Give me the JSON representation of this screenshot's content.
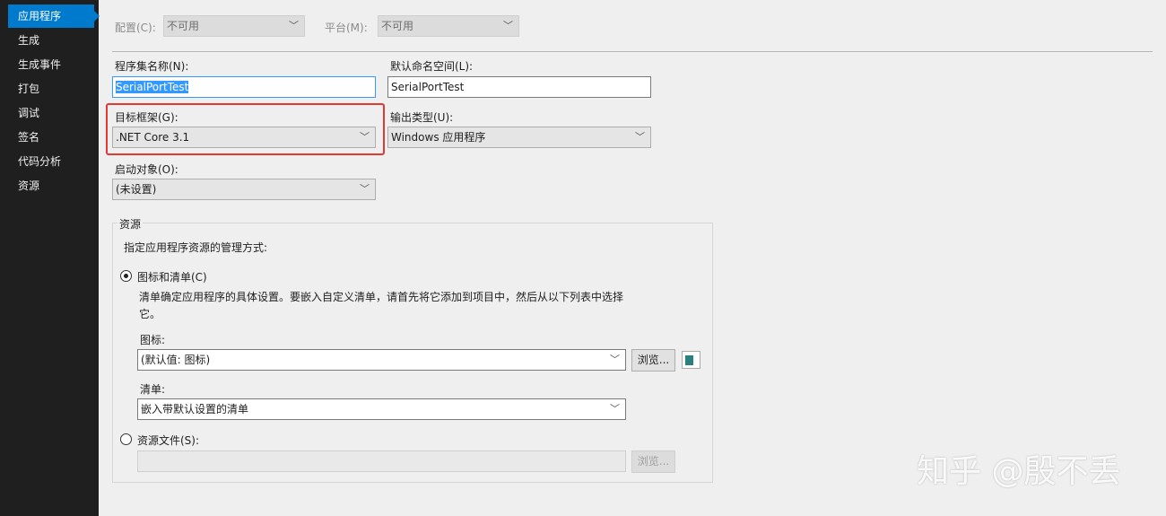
{
  "sidebar": {
    "items": [
      {
        "label": "应用程序",
        "active": true
      },
      {
        "label": "生成"
      },
      {
        "label": "生成事件"
      },
      {
        "label": "打包"
      },
      {
        "label": "调试"
      },
      {
        "label": "签名"
      },
      {
        "label": "代码分析"
      },
      {
        "label": "资源"
      }
    ]
  },
  "top": {
    "config_label": "配置(C):",
    "config_value": "不可用",
    "platform_label": "平台(M):",
    "platform_value": "不可用"
  },
  "app": {
    "assembly_label": "程序集名称(N):",
    "assembly_value": "SerialPortTest",
    "namespace_label": "默认命名空间(L):",
    "namespace_value": "SerialPortTest",
    "framework_label": "目标框架(G):",
    "framework_value": ".NET Core 3.1",
    "output_label": "输出类型(U):",
    "output_value": "Windows 应用程序",
    "startup_label": "启动对象(O):",
    "startup_value": "(未设置)"
  },
  "resources": {
    "legend": "资源",
    "intro": "指定应用程序资源的管理方式:",
    "radio_icon_manifest": "图标和清单(C)",
    "description": "清单确定应用程序的具体设置。要嵌入自定义清单，请首先将它添加到项目中，然后从以下列表中选择它。",
    "icon_label": "图标:",
    "icon_value": "(默认值: 图标)",
    "browse": "浏览...",
    "manifest_label": "清单:",
    "manifest_value": "嵌入带默认设置的清单",
    "radio_resource_file": "资源文件(S):",
    "resource_file_value": ""
  },
  "watermark": "知乎 @殷不丢",
  "colors": {
    "accent": "#007acc",
    "highlight": "#e03a32"
  }
}
